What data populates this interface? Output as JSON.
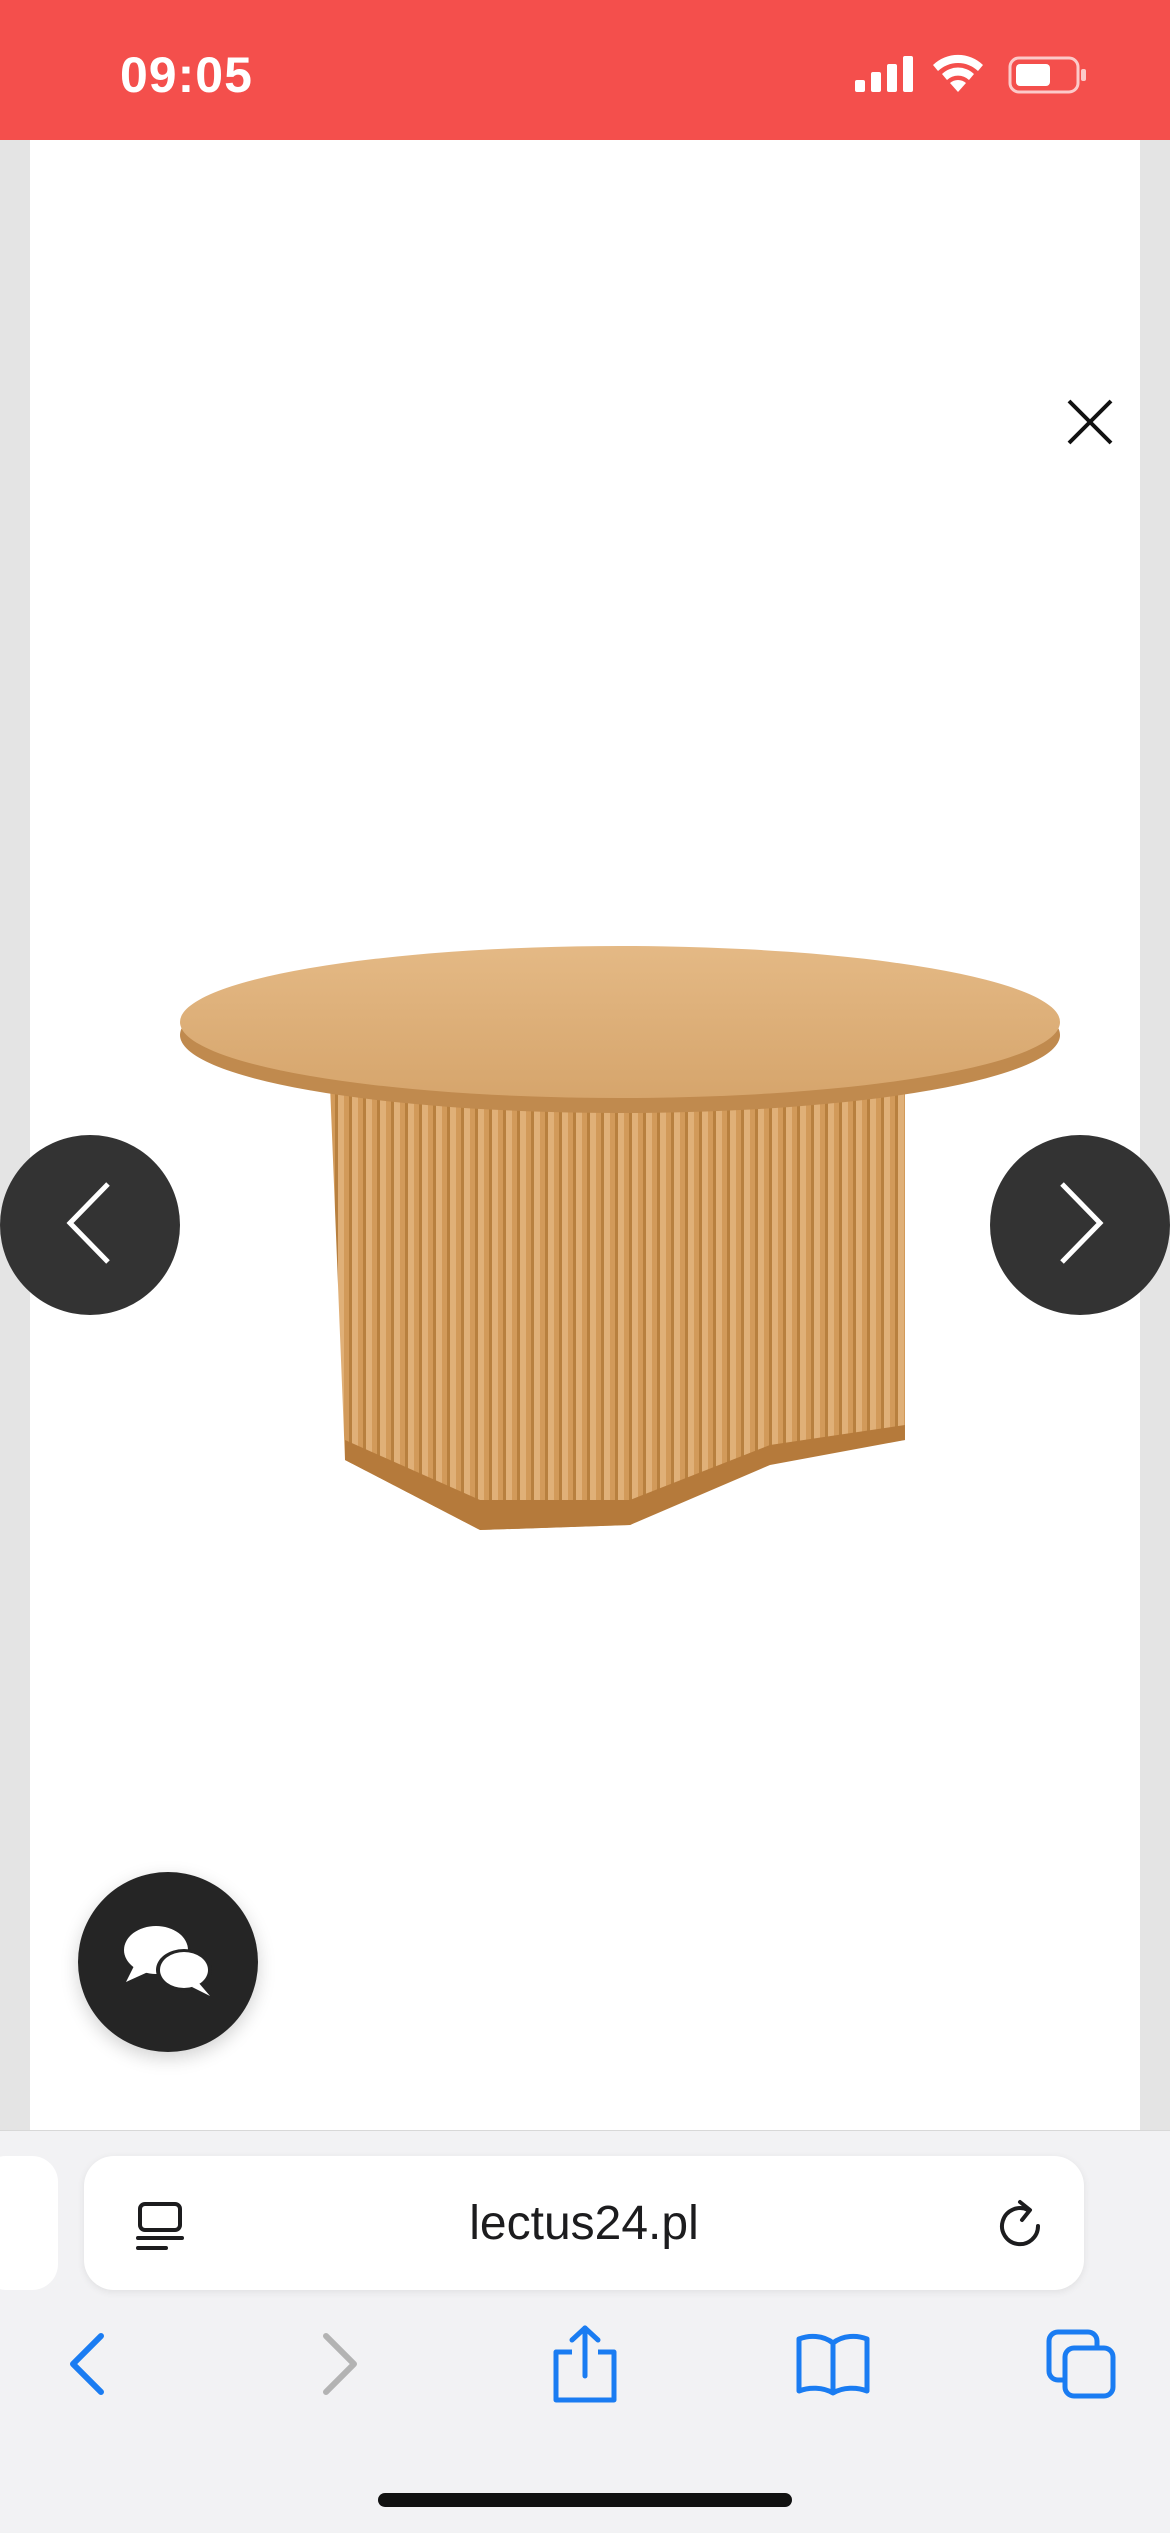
{
  "status_bar": {
    "time": "09:05",
    "background": "#f44f4c"
  },
  "viewer": {
    "close_icon": "close-icon",
    "image_alt": "Round wooden coffee table with fluted base",
    "prev_icon": "chevron-left-icon",
    "next_icon": "chevron-right-icon",
    "chat_icon": "chat-bubbles-icon"
  },
  "browser": {
    "url": "lectus24.pl",
    "accent": "#1a7cf2",
    "toolbar": [
      "back-icon",
      "forward-icon",
      "share-icon",
      "bookmarks-icon",
      "tabs-icon"
    ]
  }
}
